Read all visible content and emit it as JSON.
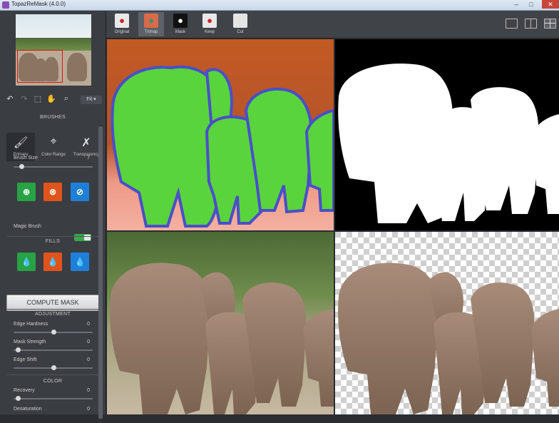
{
  "window": {
    "title": "TopazReMask (4.0.0)",
    "minimize_label": "–",
    "maximize_label": "□",
    "close_label": "✕"
  },
  "toolbar": {
    "view_tabs": [
      {
        "label": "Original",
        "icon": "apple-icon"
      },
      {
        "label": "Trimap",
        "icon": "trimap-apple-icon"
      },
      {
        "label": "Mask",
        "icon": "mask-apple-icon"
      },
      {
        "label": "Keep",
        "icon": "apple-icon"
      },
      {
        "label": "Cut",
        "icon": "blank-icon"
      }
    ],
    "active_tab": "Trimap",
    "layouts": [
      "single-view-icon",
      "split-view-icon",
      "quad-view-icon"
    ],
    "active_layout": "quad-view-icon"
  },
  "navigator": {
    "zoom_value": "Fit"
  },
  "brushes": {
    "section_title": "BRUSHES",
    "tabs": [
      {
        "label": "Primary",
        "icon": "brush-icon"
      },
      {
        "label": "Color Range",
        "icon": "color-range-icon"
      },
      {
        "label": "Transparency",
        "icon": "transparency-brush-icon"
      }
    ],
    "active_tab": "Primary",
    "brush_size_label": "Brush Size",
    "brush_size_value": "7",
    "brush_size_fraction": 0.1,
    "magic_brush_label": "Magic Brush",
    "magic_brush_on": true
  },
  "fills": {
    "section_title": "FILLS"
  },
  "compute_label": "COMPUTE MASK",
  "adjustment": {
    "section_title": "ADJUSTMENT",
    "sliders": [
      {
        "label": "Edge Hardness",
        "value": "0",
        "fraction": 0.5
      },
      {
        "label": "Mask Strength",
        "value": "0",
        "fraction": 0.05
      },
      {
        "label": "Edge Shift",
        "value": "0",
        "fraction": 0.5
      }
    ]
  },
  "color": {
    "section_title": "COLOR",
    "sliders": [
      {
        "label": "Recovery",
        "value": "0",
        "fraction": 0.05
      },
      {
        "label": "Desaturation",
        "value": "0",
        "fraction": 0.05
      }
    ]
  },
  "colors": {
    "keep_green": "#27a244",
    "cut_red": "#e0541c",
    "compute_blue": "#1e7fd8",
    "panel_bg": "#3a3d42"
  }
}
